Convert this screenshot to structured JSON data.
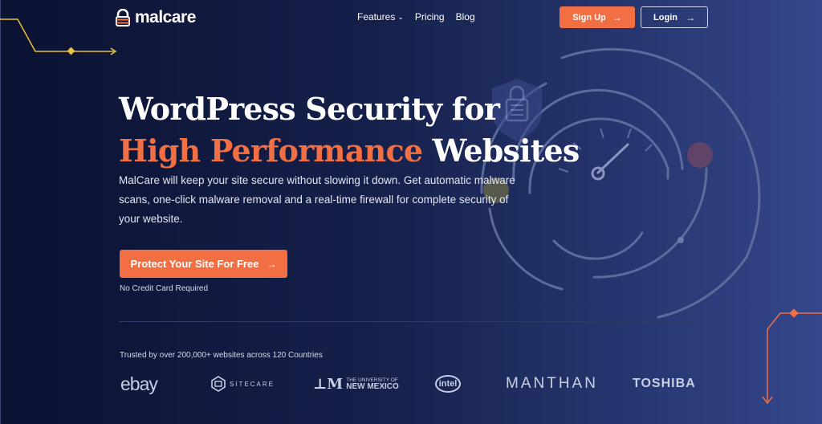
{
  "header": {
    "logo_text": "malcare",
    "nav": [
      {
        "label": "Features",
        "has_dropdown": true
      },
      {
        "label": "Pricing"
      },
      {
        "label": "Blog"
      }
    ],
    "signup_label": "Sign Up",
    "login_label": "Login"
  },
  "hero": {
    "title_line1": "WordPress Security for",
    "title_accent": "High Performance",
    "title_line2_rest": " Websites",
    "description": "MalCare will keep your site secure without slowing it down. Get automatic malware scans, one-click malware removal and a real-time firewall for complete security of your website.",
    "cta_label": "Protect Your Site For Free",
    "cta_note": "No Credit Card Required"
  },
  "trust": {
    "text": "Trusted by over 200,000+ websites across 120 Countries",
    "brands": {
      "ebay": "ebay",
      "sitecare": "SITECARE",
      "unm_small": "THE UNIVERSITY OF",
      "unm_large": "NEW MEXICO",
      "intel": "intel",
      "manthan": "MANTHAN",
      "toshiba": "TOSHIBA"
    }
  },
  "colors": {
    "accent": "#f26f44",
    "background": "#0b1232",
    "decor_line": "#e8c23a"
  },
  "icons": [
    "lock-icon",
    "chevron-down-icon",
    "arrow-right-icon",
    "shield-lock-icon",
    "speedometer-icon"
  ]
}
